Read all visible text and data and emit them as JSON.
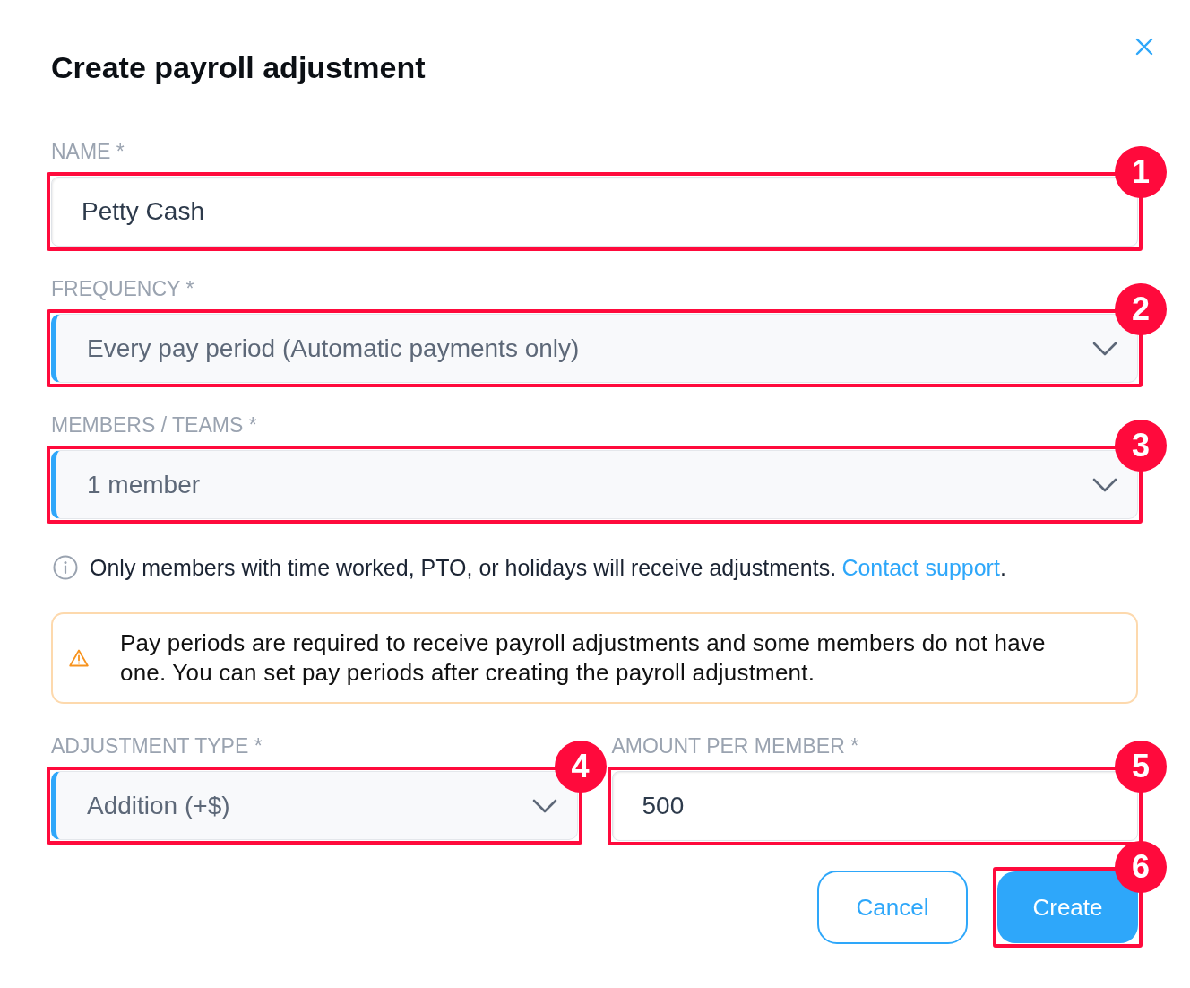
{
  "dialog": {
    "title": "Create payroll adjustment"
  },
  "fields": [
    {
      "kind": "text",
      "label": "NAME *",
      "value": "Petty Cash",
      "callout": "1"
    },
    {
      "kind": "select",
      "label": "FREQUENCY *",
      "value": "Every pay period (Automatic payments only)",
      "callout": "2"
    },
    {
      "kind": "select",
      "label": "MEMBERS / TEAMS *",
      "value": "1 member",
      "callout": "3"
    }
  ],
  "info": {
    "text": "Only members with time worked, PTO, or holidays will receive adjustments.",
    "link": "Contact support",
    "suffix": "."
  },
  "warning": {
    "text": "Pay periods are required to receive payroll adjustments and some members do not have one. You can set pay periods after creating the payroll adjustment."
  },
  "amount_row": [
    {
      "kind": "select",
      "label": "ADJUSTMENT TYPE *",
      "value": "Addition (+$)",
      "callout": "4"
    },
    {
      "kind": "text",
      "label": "AMOUNT PER MEMBER *",
      "value": "500",
      "callout": "5"
    }
  ],
  "buttons": [
    {
      "kind": "outline",
      "label": "Cancel"
    },
    {
      "kind": "primary",
      "label": "Create",
      "callout": "6"
    }
  ]
}
